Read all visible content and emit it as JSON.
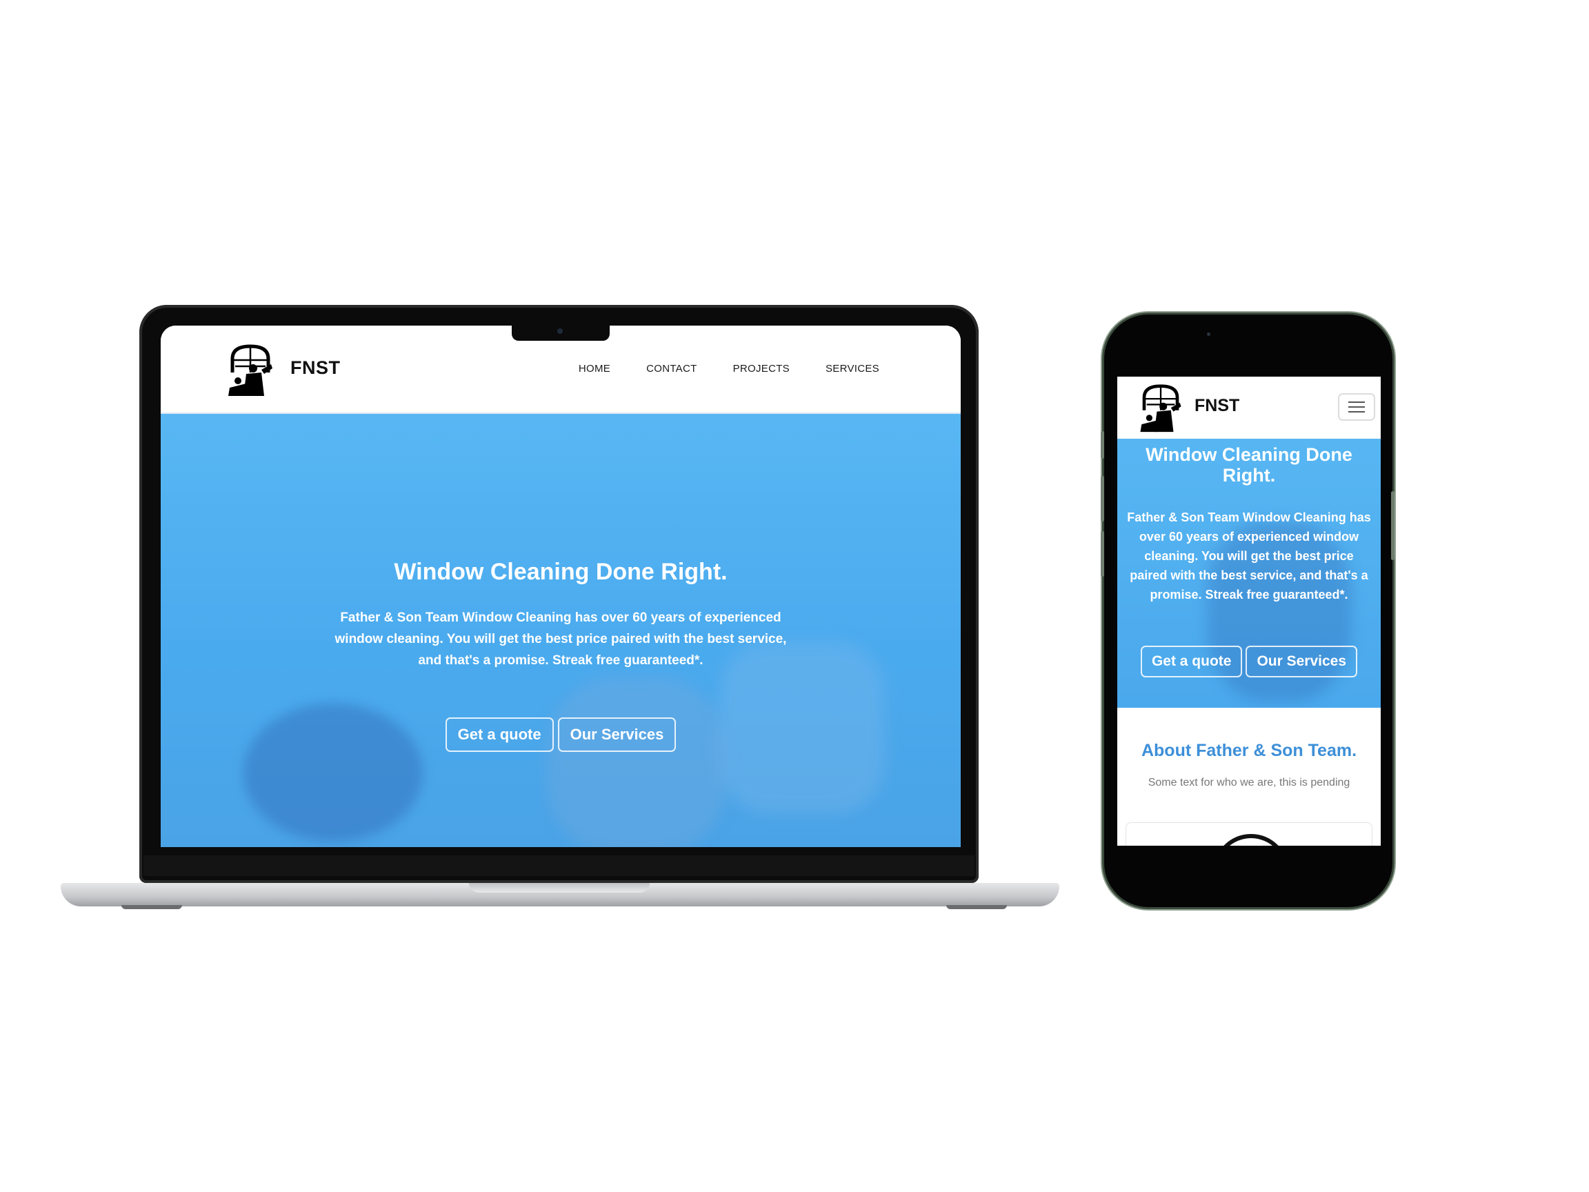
{
  "site": {
    "brand": "FNST",
    "nav": [
      "HOME",
      "CONTACT",
      "PROJECTS",
      "SERVICES"
    ],
    "hero": {
      "title": "Window Cleaning Done Right.",
      "paragraph": "Father & Son Team Window Cleaning has over 60 years of experienced window cleaning. You will get the best price paired with the best service, and that's a promise. Streak free guaranteed*.",
      "primary_button": "Get a quote",
      "secondary_button": "Our Services"
    },
    "about": {
      "title": "About Father & Son Team.",
      "text": "Some text for who we are, this is pending"
    }
  },
  "colors": {
    "hero_blue": "#4aaaee",
    "accent_blue": "#3d8fd8",
    "text_dark": "#111111"
  },
  "icons": [
    "logo-window-cleaners-icon",
    "hamburger-menu-icon"
  ]
}
